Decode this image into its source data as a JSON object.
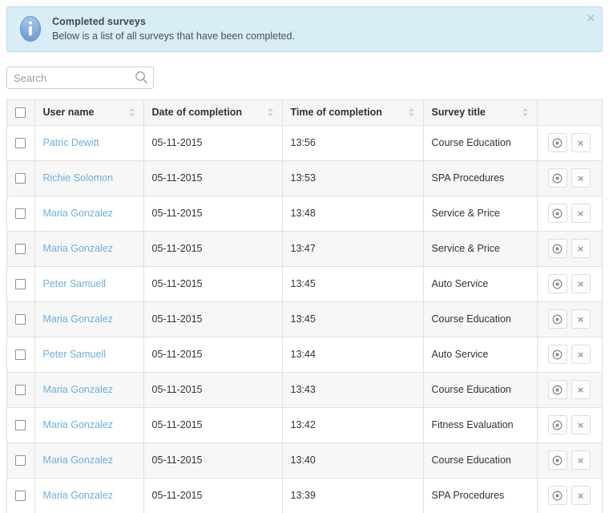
{
  "alert": {
    "icon": "info-circle-icon",
    "title": "Completed surveys",
    "description": "Below is a list of all surveys that have been completed.",
    "close_label": "×",
    "bg_color": "#d9edf7",
    "border_color": "#b3dff0"
  },
  "search": {
    "placeholder": "Search",
    "value": "",
    "icon": "search-icon"
  },
  "table": {
    "select_all_checked": false,
    "columns": [
      {
        "key": "check",
        "label": "",
        "sortable": false
      },
      {
        "key": "user",
        "label": "User name",
        "sortable": true
      },
      {
        "key": "date",
        "label": "Date of completion",
        "sortable": true
      },
      {
        "key": "time",
        "label": "Time of completion",
        "sortable": true
      },
      {
        "key": "title",
        "label": "Survey title",
        "sortable": true
      },
      {
        "key": "actions",
        "label": "",
        "sortable": false
      }
    ],
    "row_actions": [
      {
        "name": "view-button",
        "icon": "eye-icon",
        "label": ""
      },
      {
        "name": "delete-button",
        "icon": "close-x-icon",
        "label": "×"
      }
    ],
    "link_color": "#6ab0de",
    "rows": [
      {
        "checked": false,
        "user": "Patric Dewitt",
        "date": "05-11-2015",
        "time": "13:56",
        "title": "Course Education"
      },
      {
        "checked": false,
        "user": "Richie Solomon",
        "date": "05-11-2015",
        "time": "13:53",
        "title": "SPA Procedures"
      },
      {
        "checked": false,
        "user": "Maria Gonzalez",
        "date": "05-11-2015",
        "time": "13:48",
        "title": "Service & Price"
      },
      {
        "checked": false,
        "user": "Maria Gonzalez",
        "date": "05-11-2015",
        "time": "13:47",
        "title": "Service & Price"
      },
      {
        "checked": false,
        "user": "Peter Samuell",
        "date": "05-11-2015",
        "time": "13:45",
        "title": "Auto Service"
      },
      {
        "checked": false,
        "user": "Maria Gonzalez",
        "date": "05-11-2015",
        "time": "13:45",
        "title": "Course Education"
      },
      {
        "checked": false,
        "user": "Peter Samuell",
        "date": "05-11-2015",
        "time": "13:44",
        "title": "Auto Service"
      },
      {
        "checked": false,
        "user": "Maria Gonzalez",
        "date": "05-11-2015",
        "time": "13:43",
        "title": "Course Education"
      },
      {
        "checked": false,
        "user": "Maria Gonzalez",
        "date": "05-11-2015",
        "time": "13:42",
        "title": "Fitness Evaluation"
      },
      {
        "checked": false,
        "user": "Maria Gonzalez",
        "date": "05-11-2015",
        "time": "13:40",
        "title": "Course Education"
      },
      {
        "checked": false,
        "user": "Maria Gonzalez",
        "date": "05-11-2015",
        "time": "13:39",
        "title": "SPA Procedures"
      }
    ]
  }
}
